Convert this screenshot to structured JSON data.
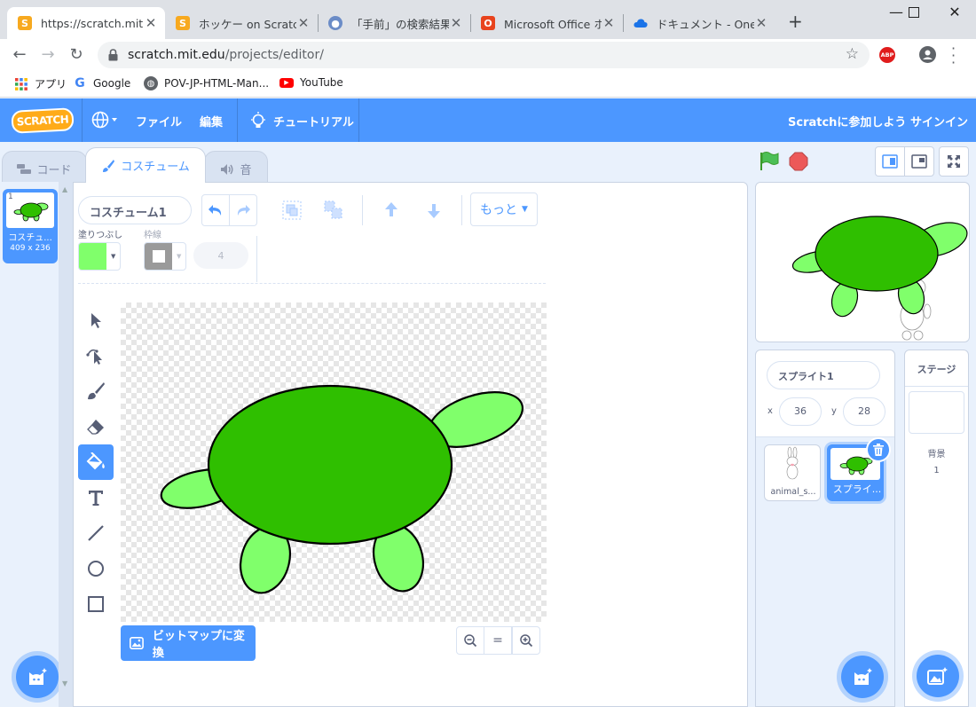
{
  "browser": {
    "tabs": [
      {
        "title": "https://scratch.mit.ed",
        "favicon": "scratch-icon",
        "active": true
      },
      {
        "title": "ホッケー on Scratch",
        "favicon": "scratch-icon",
        "active": false
      },
      {
        "title": "「手前」の検索結果 - ",
        "favicon": "search-globe-icon",
        "active": false
      },
      {
        "title": "Microsoft Office ホー",
        "favicon": "office-icon",
        "active": false
      },
      {
        "title": "ドキュメント - OneDrive",
        "favicon": "onedrive-icon",
        "active": false
      }
    ],
    "new_tab": "+",
    "url_host": "scratch.mit.edu",
    "url_path": "/projects/editor/",
    "bookmarks": [
      {
        "label": "アプリ",
        "icon": "apps-grid-icon"
      },
      {
        "label": "Google",
        "icon": "google-icon"
      },
      {
        "label": "POV-JP-HTML-Man...",
        "icon": "globe-icon"
      },
      {
        "label": "YouTube",
        "icon": "youtube-icon"
      }
    ],
    "extension_badge": "ABP"
  },
  "scratch": {
    "logo": "SCRATCH",
    "menu": {
      "file": "ファイル",
      "edit": "編集",
      "tutorials": "チュートリアル",
      "join": "Scratchに参加しよう",
      "signin": "サインイン"
    },
    "editor_tabs": {
      "code": "コード",
      "costumes": "コスチューム",
      "sounds": "音"
    },
    "costume_list": [
      {
        "index": "1",
        "name": "コスチュ...",
        "size": "409 x 236"
      }
    ],
    "paint": {
      "costume_name": "コスチューム1",
      "more": "もっと",
      "fill_label": "塗りつぶし",
      "outline_label": "枠線",
      "outline_width": "4",
      "fill_color": "#80ff6b",
      "outline_color": "#9a9a9a",
      "convert_bitmap": "ビットマップに変換",
      "zoom_reset": "="
    },
    "sprite_info": {
      "name": "スプライト1",
      "x_label": "x",
      "x": "36",
      "y_label": "y",
      "y": "28"
    },
    "sprites": [
      {
        "name": "animal_s...",
        "selected": false
      },
      {
        "name": "スプライ...",
        "selected": true
      }
    ],
    "stage_panel": {
      "title": "ステージ",
      "backdrop_label": "背景",
      "backdrop_count": "1"
    },
    "colors": {
      "accent": "#4c97ff",
      "turtle_body": "#2fbf00",
      "turtle_limb": "#80ff6b"
    }
  }
}
